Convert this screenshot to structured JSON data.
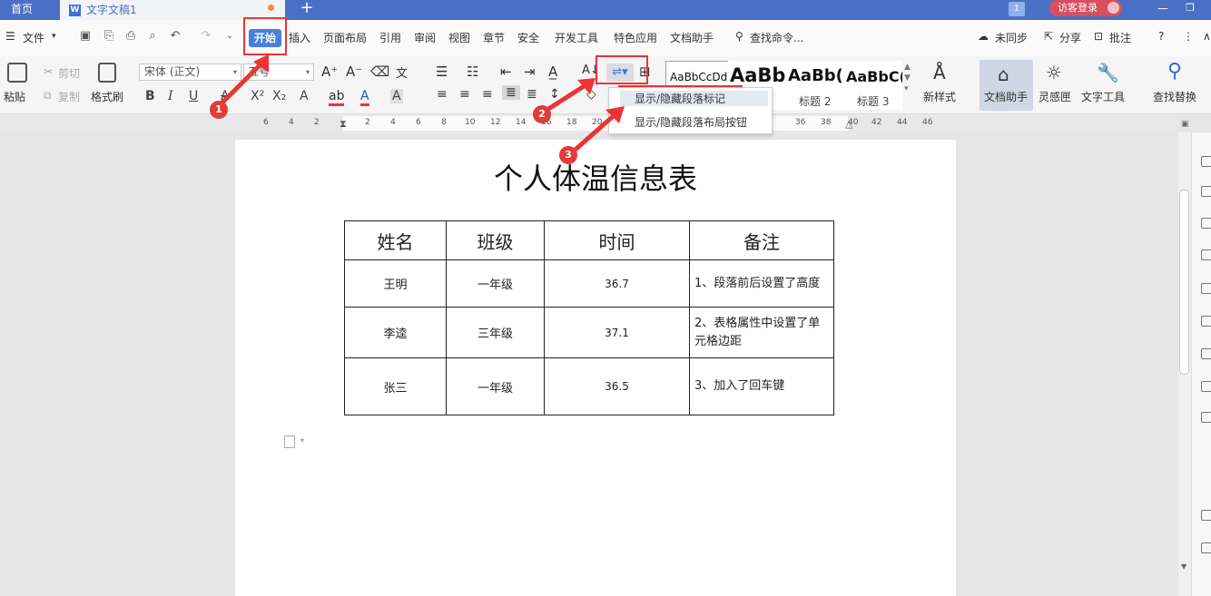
{
  "tabs": {
    "home": "首页",
    "doc": "文字文稿1",
    "new": "+"
  },
  "titlebar": {
    "badge": "1",
    "visitor": "访客登录"
  },
  "menu": {
    "file": "文件",
    "items": [
      "开始",
      "插入",
      "页面布局",
      "引用",
      "审阅",
      "视图",
      "章节",
      "安全",
      "开发工具",
      "特色应用",
      "文档助手"
    ],
    "search": "查找命令...",
    "sync": "未同步",
    "share": "分享",
    "comment": "批注",
    "help": "?"
  },
  "ribbon": {
    "paste": "粘贴",
    "cut": "剪切",
    "copy": "复制",
    "format_painter": "格式刷",
    "font": "宋体 (正文)",
    "size": "五号",
    "styles": [
      {
        "preview": "AaBbCcDd",
        "name": ""
      },
      {
        "preview": "AaBb",
        "name": ""
      },
      {
        "preview": "AaBb(",
        "name": "标题 2"
      },
      {
        "preview": "AaBbC(",
        "name": "标题 3"
      }
    ],
    "new_style": "新样式",
    "doc_assistant": "文档助手",
    "inspiration": "灵感匣",
    "text_tools": "文字工具",
    "find_replace": "查找替换"
  },
  "dropdown": {
    "item1": "显示/隐藏段落标记",
    "item2": "显示/隐藏段落布局按钮"
  },
  "ruler": {
    "ticks": [
      "6",
      "4",
      "2",
      "2",
      "4",
      "6",
      "8",
      "10",
      "12",
      "14",
      "16",
      "18",
      "20",
      "40",
      "42",
      "44",
      "46",
      "36",
      "38"
    ]
  },
  "document": {
    "title": "个人体温信息表",
    "headers": [
      "姓名",
      "班级",
      "时间",
      "备注"
    ],
    "rows": [
      [
        "王明",
        "一年级",
        "36.7",
        "1、段落前后设置了高度"
      ],
      [
        "李逵",
        "三年级",
        "37.1",
        "2、表格属性中设置了单元格边距"
      ],
      [
        "张三",
        "一年级",
        "36.5",
        "3、加入了回车键"
      ]
    ]
  },
  "annotations": [
    "1",
    "2",
    "3"
  ],
  "colors": {
    "accent": "#4a70c6",
    "annotation": "#e33333"
  }
}
